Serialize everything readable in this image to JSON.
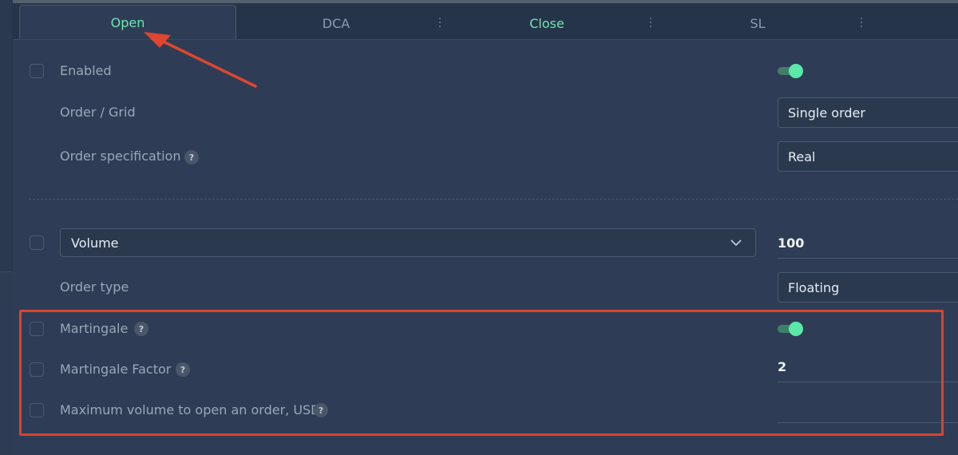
{
  "tabs": [
    {
      "label": "Open",
      "color": "#6ee7b0",
      "active": true
    },
    {
      "label": "DCA",
      "color": "#8f9bab",
      "active": false
    },
    {
      "label": "Close",
      "color": "#6ee7b0",
      "active": false
    },
    {
      "label": "SL",
      "color": "#8f9bab",
      "active": false
    }
  ],
  "rows": {
    "enabled": {
      "label": "Enabled",
      "toggle": true
    },
    "order_grid": {
      "label": "Order / Grid",
      "value": "Single order"
    },
    "order_spec": {
      "label": "Order specification",
      "help": "?",
      "value": "Real"
    },
    "volume": {
      "select": "Volume",
      "value": "100"
    },
    "order_type": {
      "label": "Order type",
      "value": "Floating"
    },
    "martingale": {
      "label": "Martingale",
      "help": "?",
      "toggle": true
    },
    "martingale_factor": {
      "label": "Martingale Factor",
      "help": "?",
      "value": "2"
    },
    "max_volume": {
      "label": "Maximum volume to open an order, USD",
      "help": "?",
      "value": ""
    }
  },
  "colors": {
    "accent": "#5be8a9",
    "highlight": "#d8442f",
    "background": "#2e3d55"
  }
}
